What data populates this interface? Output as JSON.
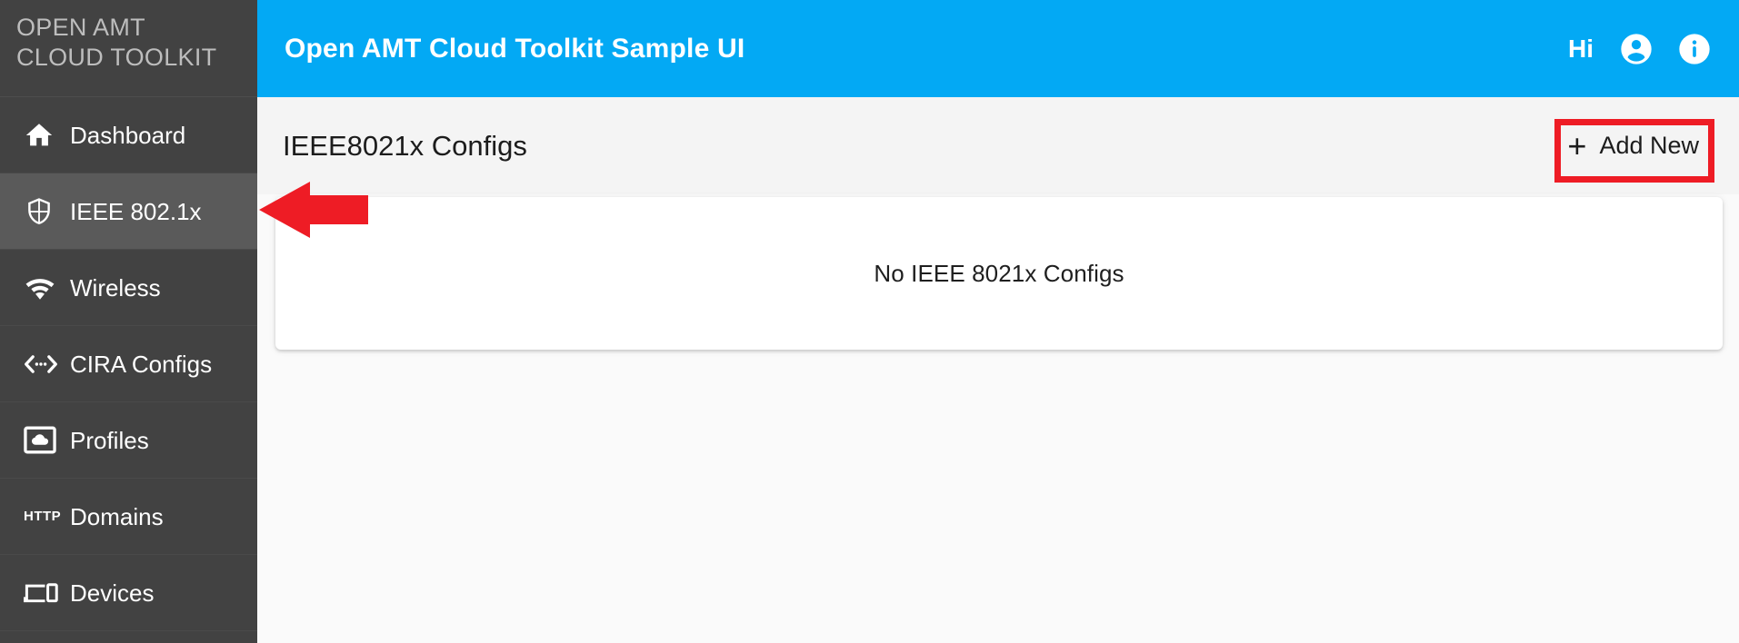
{
  "sidebar": {
    "brand": "OPEN AMT\nCLOUD TOOLKIT",
    "items": [
      {
        "label": "Dashboard",
        "icon": "home-icon",
        "active": false
      },
      {
        "label": "IEEE 802.1x",
        "icon": "shield-icon",
        "active": true
      },
      {
        "label": "Wireless",
        "icon": "wifi-icon",
        "active": false
      },
      {
        "label": "CIRA Configs",
        "icon": "code-arrows-icon",
        "active": false
      },
      {
        "label": "Profiles",
        "icon": "cloud-box-icon",
        "active": false
      },
      {
        "label": "Domains",
        "icon": "http-icon",
        "active": false
      },
      {
        "label": "Devices",
        "icon": "devices-icon",
        "active": false
      }
    ]
  },
  "topbar": {
    "title": "Open AMT Cloud Toolkit Sample UI",
    "greeting": "Hi",
    "account_icon": "account-circle-icon",
    "info_icon": "info-circle-icon",
    "background": "#03a9f4"
  },
  "toolbar": {
    "page_title": "IEEE8021x Configs",
    "add_new_label": "Add New",
    "add_new_icon": "plus-icon"
  },
  "content": {
    "empty_message": "No IEEE 8021x Configs"
  },
  "annotations": {
    "highlight_color": "#ee1c25",
    "box_target": "add-new-button",
    "arrow_target": "sidebar-item-ieee-802-1x",
    "arrow_direction": "left"
  }
}
